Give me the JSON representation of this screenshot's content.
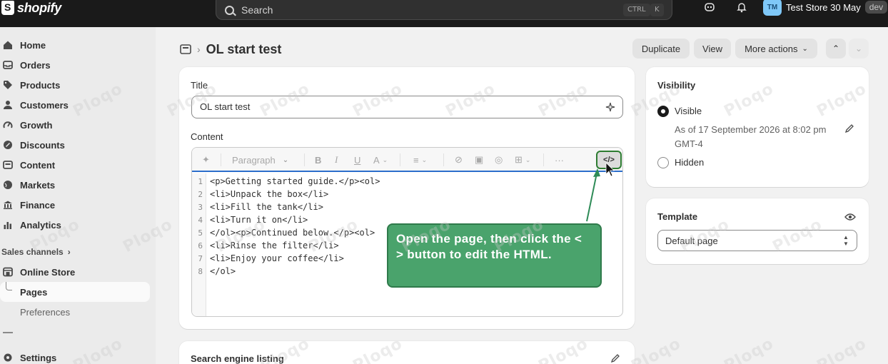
{
  "brand": {
    "logo_text": "shopify"
  },
  "search": {
    "placeholder": "Search",
    "shortcut_1": "CTRL",
    "shortcut_2": "K"
  },
  "store": {
    "initials": "TM",
    "name": "Test Store 30 May",
    "badge": "dev"
  },
  "sidebar": {
    "items": [
      {
        "label": "Home",
        "icon": "home-icon"
      },
      {
        "label": "Orders",
        "icon": "orders-icon"
      },
      {
        "label": "Products",
        "icon": "tag-icon"
      },
      {
        "label": "Customers",
        "icon": "person-icon"
      },
      {
        "label": "Growth",
        "icon": "gauge-icon"
      },
      {
        "label": "Discounts",
        "icon": "discount-icon"
      },
      {
        "label": "Content",
        "icon": "content-icon"
      },
      {
        "label": "Markets",
        "icon": "globe-icon"
      },
      {
        "label": "Finance",
        "icon": "bank-icon"
      },
      {
        "label": "Analytics",
        "icon": "chart-icon"
      }
    ],
    "sales_channels_label": "Sales channels",
    "online_store_label": "Online Store",
    "pages_label": "Pages",
    "preferences_label": "Preferences",
    "settings_label": "Settings"
  },
  "header": {
    "title": "OL start test",
    "duplicate_label": "Duplicate",
    "view_label": "View",
    "more_actions_label": "More actions"
  },
  "main": {
    "title_label": "Title",
    "title_value": "OL start test",
    "content_label": "Content",
    "toolbar": {
      "paragraph_label": "Paragraph",
      "more_label": "···"
    },
    "code_lines": [
      "<p>Getting started guide.</p><ol>",
      "<li>Unpack the box</li>",
      "<li>Fill the tank</li>",
      "<li>Turn it on</li>",
      "</ol><p>Continued below.</p><ol>",
      "<li>Rinse the filter</li>",
      "<li>Enjoy your coffee</li>",
      "</ol>"
    ],
    "seo_label": "Search engine listing"
  },
  "callout": {
    "text": "Open the page, then click the < > button to edit the HTML."
  },
  "visibility": {
    "heading": "Visibility",
    "visible_label": "Visible",
    "visible_date": "As of 17 September 2026 at 8:02 pm GMT-4",
    "hidden_label": "Hidden",
    "selected": "Visible"
  },
  "template": {
    "heading": "Template",
    "selected": "Default page"
  },
  "watermark": "Ploqo",
  "colors": {
    "topbar": "#1a1a1a",
    "callout": "#4aa36c",
    "accent_border": "#2c6ecb"
  }
}
